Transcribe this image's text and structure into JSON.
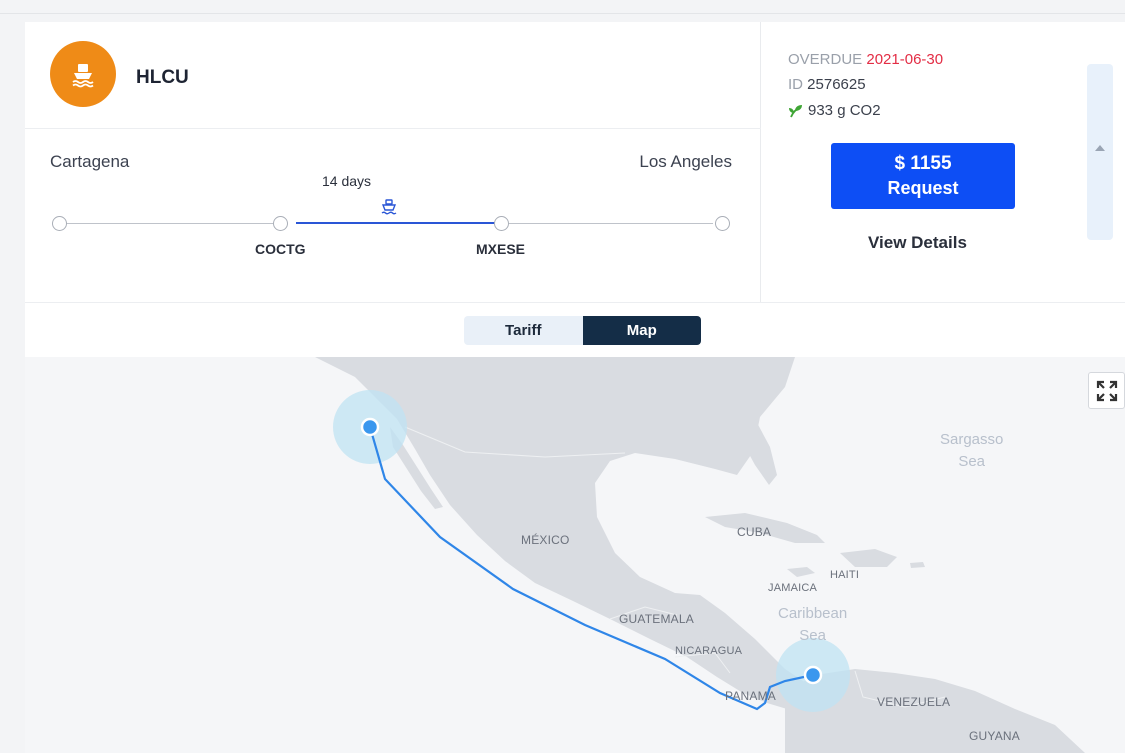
{
  "carrier": {
    "name": "HLCU",
    "logo_icon": "ship-icon",
    "logo_color": "#ef8b17"
  },
  "route": {
    "origin_city": "Cartagena",
    "destination_city": "Los Angeles",
    "transit": "14 days",
    "origin_port": "COCTG",
    "destination_port": "MXESE"
  },
  "status": {
    "overdue_label": "OVERDUE",
    "overdue_date": "2021-06-30",
    "id_label": "ID",
    "id_value": "2576625",
    "co2": "933 g CO2"
  },
  "offer": {
    "price": "$ 1155",
    "request_label": "Request",
    "details_label": "View Details"
  },
  "tabs": [
    {
      "label": "Tariff",
      "active": false
    },
    {
      "label": "Map",
      "active": true
    }
  ],
  "map": {
    "labels": {
      "mexico": "MÉXICO",
      "cuba": "CUBA",
      "haiti": "HAITI",
      "jamaica": "JAMAICA",
      "guatemala": "GUATEMALA",
      "nicaragua": "NICARAGUA",
      "panama": "PANAMA",
      "venezuela": "VENEZUELA",
      "guyana": "GUYANA"
    },
    "seas": {
      "sargasso_1": "Sargasso",
      "sargasso_2": "Sea",
      "caribbean_1": "Caribbean",
      "caribbean_2": "Sea"
    }
  },
  "colors": {
    "accent": "#0d4ef5",
    "overdue": "#e32d45",
    "route": "#2a56d6",
    "route_map": "#2f86e8",
    "tab_active": "#142d47"
  }
}
